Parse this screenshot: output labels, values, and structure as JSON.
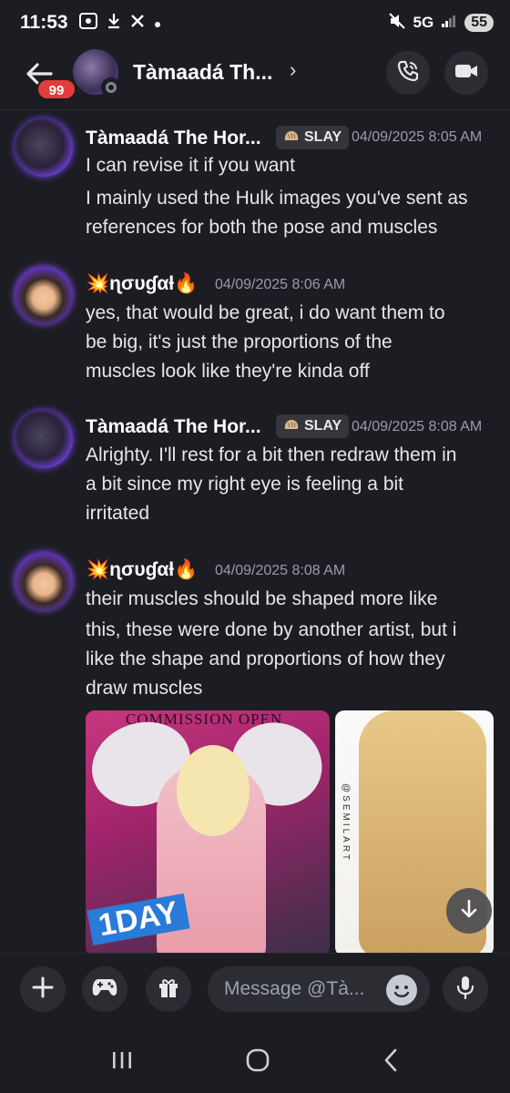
{
  "status_bar": {
    "time": "11:53",
    "network": "5G",
    "battery": "55"
  },
  "header": {
    "unread_count": "99",
    "title": "Tàmaadá Th...",
    "chevron": "›"
  },
  "messages": [
    {
      "author": "Tàmaadá The Hor...",
      "tag": "SLAY",
      "timestamp": "04/09/2025 8:05 AM",
      "lines": [
        "I can revise it if you want",
        "I mainly used the Hulk images you've sent as",
        "references for both the pose and muscles"
      ]
    },
    {
      "author_prefix": "💥",
      "author": "ɳσυɠαƚ",
      "author_suffix": "🔥",
      "timestamp": "04/09/2025 8:06 AM",
      "lines": [
        "yes, that would be great, i do want them to",
        "be big, it's just the proportions of the",
        "muscles look like they're kinda off"
      ]
    },
    {
      "author": "Tàmaadá The Hor...",
      "tag": "SLAY",
      "timestamp": "04/09/2025 8:08 AM",
      "lines": [
        "Alrighty. I'll rest for a bit then redraw them in",
        "a bit since my right eye is feeling a bit",
        "irritated"
      ]
    },
    {
      "author_prefix": "💥",
      "author": "ɳσυɠαƚ",
      "author_suffix": "🔥",
      "timestamp": "04/09/2025 8:08 AM",
      "lines": [
        "their muscles should be shaped more like",
        "this, these were done by another artist, but i",
        "like the shape and proportions of how they",
        "draw muscles"
      ]
    }
  ],
  "attachments": {
    "left_caption": "COMMISSION OPEN",
    "left_badge": "1DAY",
    "right_watermark": "@SEMILART"
  },
  "composer": {
    "placeholder": "Message @Tà..."
  },
  "colors": {
    "background": "#1c1d22",
    "badge_red": "#e23c3c",
    "button_bg": "#2b2d33"
  }
}
